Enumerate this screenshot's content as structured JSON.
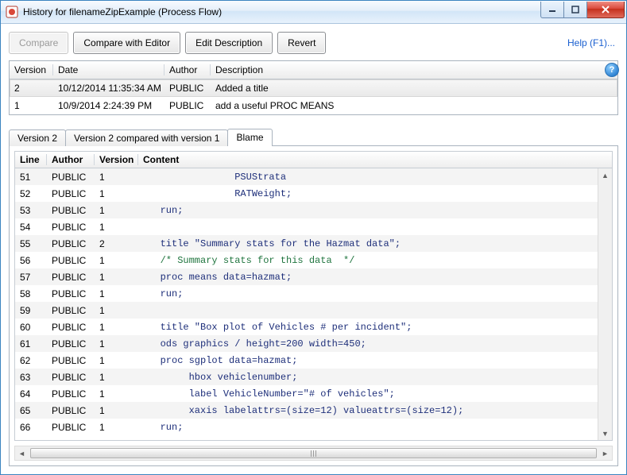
{
  "window": {
    "title": "History for filenameZipExample (Process Flow)"
  },
  "toolbar": {
    "compare": "Compare",
    "compare_with_editor": "Compare with Editor",
    "edit_description": "Edit Description",
    "revert": "Revert",
    "help": "Help (F1)..."
  },
  "versions": {
    "headers": {
      "version": "Version",
      "date": "Date",
      "author": "Author",
      "description": "Description"
    },
    "rows": [
      {
        "version": "2",
        "date": "10/12/2014 11:35:34 AM",
        "author": "PUBLIC",
        "description": "Added a title",
        "selected": true
      },
      {
        "version": "1",
        "date": "10/9/2014 2:24:39 PM",
        "author": "PUBLIC",
        "description": "add a useful PROC MEANS",
        "selected": false
      }
    ]
  },
  "tabs": {
    "items": [
      {
        "label": "Version 2",
        "active": false
      },
      {
        "label": "Version 2 compared with version 1",
        "active": false
      },
      {
        "label": "Blame",
        "active": true
      }
    ]
  },
  "blame": {
    "headers": {
      "line": "Line",
      "author": "Author",
      "version": "Version",
      "content": "Content"
    },
    "rows": [
      {
        "line": "51",
        "author": "PUBLIC",
        "version": "1",
        "content": "                PSUStrata",
        "cls": "kw"
      },
      {
        "line": "52",
        "author": "PUBLIC",
        "version": "1",
        "content": "                RATWeight;",
        "cls": "kw"
      },
      {
        "line": "53",
        "author": "PUBLIC",
        "version": "1",
        "content": "   run;",
        "cls": "kw"
      },
      {
        "line": "54",
        "author": "PUBLIC",
        "version": "1",
        "content": "",
        "cls": "kw"
      },
      {
        "line": "55",
        "author": "PUBLIC",
        "version": "2",
        "content": "   title \"Summary stats for the Hazmat data\";",
        "cls": "str"
      },
      {
        "line": "56",
        "author": "PUBLIC",
        "version": "1",
        "content": "   /* Summary stats for this data  */",
        "cls": "cmt"
      },
      {
        "line": "57",
        "author": "PUBLIC",
        "version": "1",
        "content": "   proc means data=hazmat;",
        "cls": "kw"
      },
      {
        "line": "58",
        "author": "PUBLIC",
        "version": "1",
        "content": "   run;",
        "cls": "kw"
      },
      {
        "line": "59",
        "author": "PUBLIC",
        "version": "1",
        "content": "",
        "cls": "kw"
      },
      {
        "line": "60",
        "author": "PUBLIC",
        "version": "1",
        "content": "   title \"Box plot of Vehicles # per incident\";",
        "cls": "str"
      },
      {
        "line": "61",
        "author": "PUBLIC",
        "version": "1",
        "content": "   ods graphics / height=200 width=450;",
        "cls": "kw"
      },
      {
        "line": "62",
        "author": "PUBLIC",
        "version": "1",
        "content": "   proc sgplot data=hazmat;",
        "cls": "kw"
      },
      {
        "line": "63",
        "author": "PUBLIC",
        "version": "1",
        "content": "        hbox vehiclenumber;",
        "cls": "kw"
      },
      {
        "line": "64",
        "author": "PUBLIC",
        "version": "1",
        "content": "        label VehicleNumber=\"# of vehicles\";",
        "cls": "str"
      },
      {
        "line": "65",
        "author": "PUBLIC",
        "version": "1",
        "content": "        xaxis labelattrs=(size=12) valueattrs=(size=12);",
        "cls": "kw"
      },
      {
        "line": "66",
        "author": "PUBLIC",
        "version": "1",
        "content": "   run;",
        "cls": "kw"
      }
    ]
  }
}
